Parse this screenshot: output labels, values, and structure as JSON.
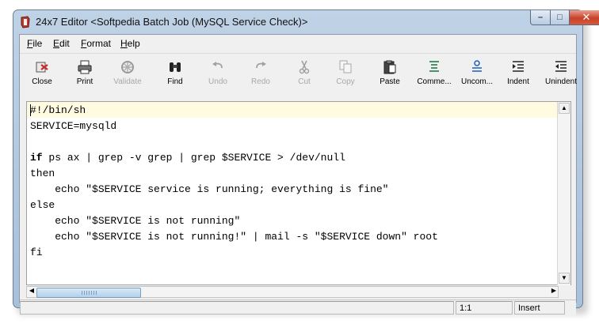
{
  "window": {
    "title": "24x7 Editor <Softpedia Batch Job (MySQL Service Check)>",
    "controls": {
      "minimize": "–",
      "maximize": "□",
      "close": "✕"
    }
  },
  "menu": [
    {
      "label": "File",
      "mnemonic": "F",
      "rest": "ile"
    },
    {
      "label": "Edit",
      "mnemonic": "E",
      "rest": "dit"
    },
    {
      "label": "Format",
      "mnemonic": "F",
      "rest": "ormat"
    },
    {
      "label": "Help",
      "mnemonic": "H",
      "rest": "elp"
    }
  ],
  "toolbar": [
    {
      "label": "Close",
      "icon": "close-doc-icon",
      "enabled": true
    },
    {
      "label": "Print",
      "icon": "printer-icon",
      "enabled": true
    },
    {
      "label": "Validate",
      "icon": "validate-icon",
      "enabled": false
    },
    {
      "label": "Find",
      "icon": "binoculars-icon",
      "enabled": true
    },
    {
      "label": "Undo",
      "icon": "undo-icon",
      "enabled": false
    },
    {
      "label": "Redo",
      "icon": "redo-icon",
      "enabled": false
    },
    {
      "label": "Cut",
      "icon": "scissors-icon",
      "enabled": false
    },
    {
      "label": "Copy",
      "icon": "copy-icon",
      "enabled": false
    },
    {
      "label": "Paste",
      "icon": "clipboard-icon",
      "enabled": true
    },
    {
      "label": "Comme...",
      "icon": "comment-icon",
      "enabled": true
    },
    {
      "label": "Uncom...",
      "icon": "uncomment-icon",
      "enabled": true
    },
    {
      "label": "Indent",
      "icon": "indent-icon",
      "enabled": true
    },
    {
      "label": "Unindent",
      "icon": "unindent-icon",
      "enabled": true
    }
  ],
  "editor": {
    "lines": [
      "#!/bin/sh",
      "SERVICE=mysqld",
      "",
      "if ps ax | grep -v grep | grep $SERVICE > /dev/null",
      "then",
      "    echo \"$SERVICE service is running; everything is fine\"",
      "else",
      "    echo \"$SERVICE is not running\"",
      "    echo \"$SERVICE is not running!\" | mail -s \"$SERVICE down\" root",
      "fi"
    ]
  },
  "status": {
    "position": "1:1",
    "mode": "Insert"
  },
  "colors": {
    "current_line": "#fffbe0",
    "title_bar": "#bfd2e6",
    "close_button": "#c7412a"
  }
}
